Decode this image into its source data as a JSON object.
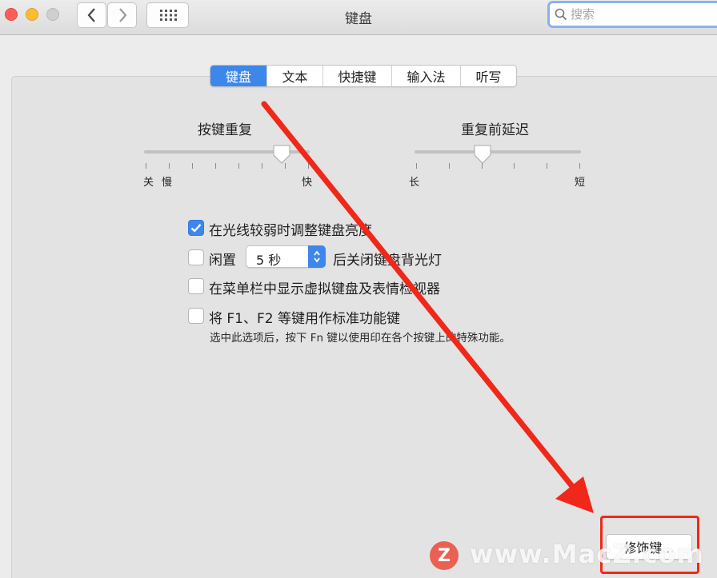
{
  "window": {
    "title": "键盘"
  },
  "search": {
    "placeholder": "搜索"
  },
  "tabs": [
    {
      "label": "键盘",
      "active": true
    },
    {
      "label": "文本",
      "active": false
    },
    {
      "label": "快捷键",
      "active": false
    },
    {
      "label": "输入法",
      "active": false
    },
    {
      "label": "听写",
      "active": false
    }
  ],
  "key_repeat": {
    "title": "按键重复",
    "label_off": "关",
    "label_slow": "慢",
    "label_fast": "快",
    "level": 0.83
  },
  "delay_until_repeat": {
    "title": "重复前延迟",
    "label_long": "长",
    "label_short": "短",
    "level": 0.41
  },
  "options": {
    "adjust_brightness": {
      "label": "在光线较弱时调整键盘亮度",
      "checked": true
    },
    "backlight_off": {
      "prefix": "闲置",
      "select_value": "5 秒",
      "suffix": "后关闭键盘背光灯",
      "checked": false
    },
    "show_viewer": {
      "label": "在菜单栏中显示虚拟键盘及表情检视器",
      "checked": false
    },
    "function_keys": {
      "label": "将 F1、F2 等键用作标准功能键",
      "note": "选中此选项后，按下 Fn 键以使用印在各个按键上的特殊功能。",
      "checked": false
    }
  },
  "modifier_button": {
    "label": "修饰键..."
  },
  "watermark": {
    "badge": "Z",
    "text": "www.MacZ.com"
  },
  "colors": {
    "accent": "#3e87ea",
    "annotation": "#f0281a"
  }
}
